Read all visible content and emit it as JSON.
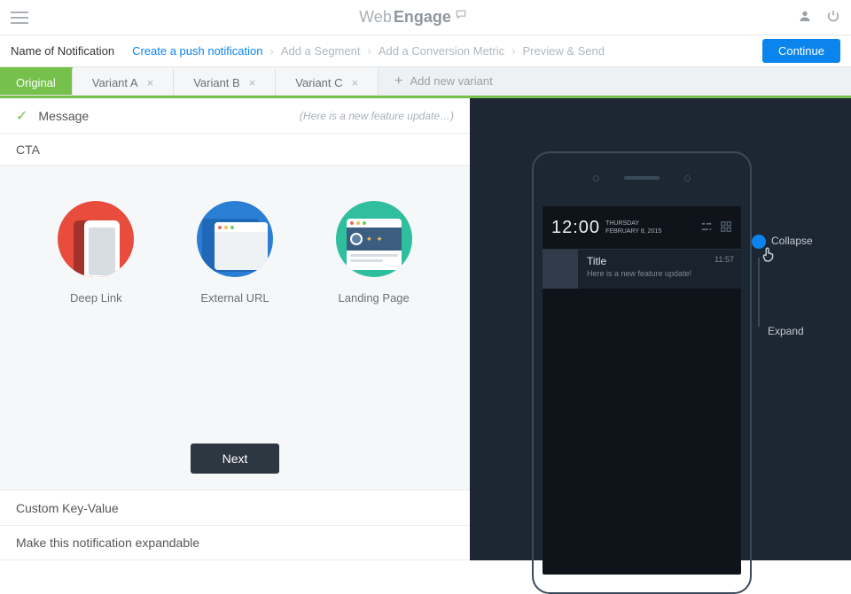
{
  "brand": {
    "part1": "Web",
    "part2": "Engage"
  },
  "subheader": {
    "title": "Name of Notification",
    "steps": [
      {
        "label": "Create a push notification",
        "active": true
      },
      {
        "label": "Add a Segment",
        "active": false
      },
      {
        "label": "Add a Conversion Metric",
        "active": false
      },
      {
        "label": "Preview & Send",
        "active": false
      }
    ],
    "continue_label": "Continue"
  },
  "variants": {
    "original": "Original",
    "tabs": [
      "Variant A",
      "Variant B",
      "Variant C"
    ],
    "add_label": "Add new variant"
  },
  "sections": {
    "message": {
      "label": "Message",
      "hint": "(Here is a new feature update…)"
    },
    "cta": {
      "label": "CTA",
      "options": {
        "deep_link": "Deep Link",
        "external_url": "External URL",
        "landing_page": "Landing Page"
      },
      "next_label": "Next"
    },
    "custom_kv": "Custom Key-Value",
    "expandable": "Make this notification expandable"
  },
  "preview": {
    "clock": "12:00",
    "day": "THURSDAY",
    "date": "FEBRUARY 8, 2015",
    "notif_title": "Title",
    "notif_text": "Here is a new feature update!",
    "notif_time": "11:57",
    "collapse_label": "Collapse",
    "expand_label": "Expand"
  }
}
